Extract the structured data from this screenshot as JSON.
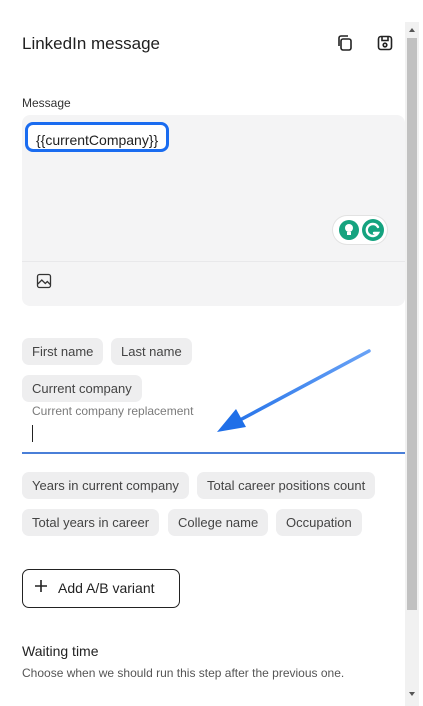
{
  "header": {
    "title": "LinkedIn message",
    "icons": [
      "copy-icon",
      "save-icon"
    ]
  },
  "editor": {
    "label": "Message",
    "token": "{{currentCompany}}"
  },
  "variables": {
    "row1": [
      "First name",
      "Last name"
    ],
    "current_company": "Current company",
    "replacement_label": "Current company replacement",
    "replacement_value": "",
    "row2": [
      "Years in current company",
      "Total career positions count"
    ],
    "row3": [
      "Total years in career",
      "College name",
      "Occupation"
    ]
  },
  "actions": {
    "add_ab_variant": "Add A/B variant"
  },
  "waiting": {
    "title": "Waiting time",
    "description": "Choose when we should run this step after the previous one."
  },
  "colors": {
    "token_border": "#1a6cf0",
    "annotation_arrow": "#1f6fe8",
    "grammarly": "#15a37f",
    "input_underline": "#4a7fd8"
  }
}
